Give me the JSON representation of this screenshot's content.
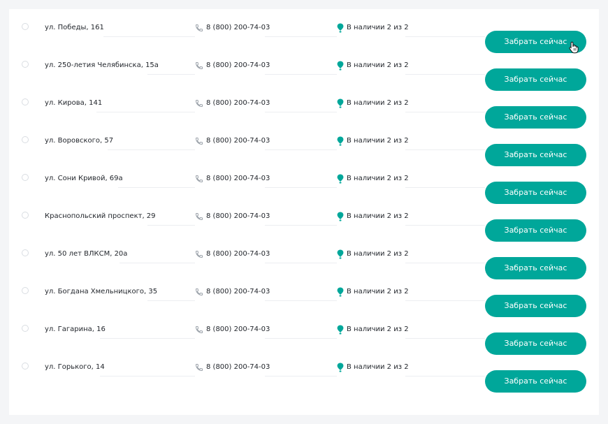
{
  "stores": [
    {
      "address": "ул. Победы, 161",
      "phone": "8 (800) 200-74-03",
      "stock": "В наличии 2 из 2",
      "button_label": "Забрать сейчас"
    },
    {
      "address": "ул. 250-летия Челябинска, 15а",
      "phone": "8 (800) 200-74-03",
      "stock": "В наличии 2 из 2",
      "button_label": "Забрать сейчас"
    },
    {
      "address": "ул. Кирова, 141",
      "phone": "8 (800) 200-74-03",
      "stock": "В наличии 2 из 2",
      "button_label": "Забрать сейчас"
    },
    {
      "address": "ул. Воровского, 57",
      "phone": "8 (800) 200-74-03",
      "stock": "В наличии 2 из 2",
      "button_label": "Забрать сейчас"
    },
    {
      "address": "ул. Сони Кривой, 69а",
      "phone": "8 (800) 200-74-03",
      "stock": "В наличии 2 из 2",
      "button_label": "Забрать сейчас"
    },
    {
      "address": "Краснопольский проспект, 29",
      "phone": "8 (800) 200-74-03",
      "stock": "В наличии 2 из 2",
      "button_label": "Забрать сейчас"
    },
    {
      "address": "ул. 50 лет ВЛКСМ, 20а",
      "phone": "8 (800) 200-74-03",
      "stock": "В наличии 2 из 2",
      "button_label": "Забрать сейчас"
    },
    {
      "address": "ул. Богдана Хмельницкого, 35",
      "phone": "8 (800) 200-74-03",
      "stock": "В наличии 2 из 2",
      "button_label": "Забрать сейчас"
    },
    {
      "address": "ул. Гагарина, 16",
      "phone": "8 (800) 200-74-03",
      "stock": "В наличии 2 из 2",
      "button_label": "Забрать сейчас"
    },
    {
      "address": "ул. Горького, 14",
      "phone": "8 (800) 200-74-03",
      "stock": "В наличии 2 из 2",
      "button_label": "Забрать сейчас"
    }
  ],
  "icons": {
    "phone": "phone-icon",
    "stock": "map-pin-icon",
    "cursor": "hand-pointer-icon"
  },
  "colors": {
    "accent": "#00a79a",
    "background": "#f4f5f7",
    "panel": "#ffffff",
    "text": "#1f2329",
    "phone_icon": "#9aa1a9"
  }
}
